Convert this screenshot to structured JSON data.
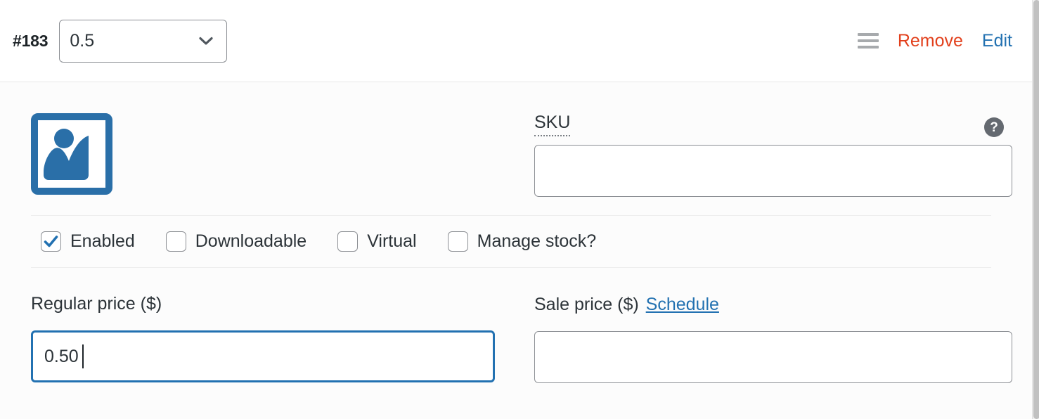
{
  "variation": {
    "id_label": "#183",
    "attribute_select": {
      "value": "0.5",
      "options": [
        "0.5"
      ],
      "icon": "chevron-down-icon"
    },
    "actions": {
      "drag_handle_icon": "drag-handle-icon",
      "remove_label": "Remove",
      "edit_label": "Edit"
    },
    "thumbnail": {
      "icon": "image-placeholder-icon",
      "color": "#2a6fa8"
    },
    "sku": {
      "label": "SKU",
      "value": "",
      "placeholder": "",
      "help_icon": "help-circle-icon"
    },
    "checkboxes": [
      {
        "label": "Enabled",
        "checked": true
      },
      {
        "label": "Downloadable",
        "checked": false
      },
      {
        "label": "Virtual",
        "checked": false
      },
      {
        "label": "Manage stock?",
        "checked": false
      }
    ],
    "regular_price": {
      "label": "Regular price ($)",
      "value": "0.50",
      "placeholder": "",
      "focused": true
    },
    "sale_price": {
      "label": "Sale price ($)",
      "schedule_link": "Schedule",
      "value": "",
      "placeholder": ""
    }
  },
  "colors": {
    "remove": "#e2401c",
    "edit": "#2271b1",
    "link": "#2271b1",
    "checkbox_accent": "#2271b1",
    "focus_border": "#2271b1",
    "help_bg": "#646970"
  }
}
